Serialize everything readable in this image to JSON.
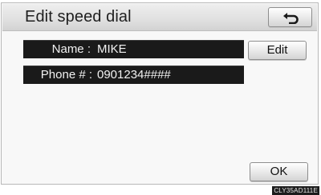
{
  "screen": {
    "title": "Edit speed dial",
    "back_icon": "return-arrow-icon"
  },
  "fields": {
    "name_label": "Name :",
    "name_value": "MIKE",
    "phone_label": "Phone # :",
    "phone_value": "0901234####"
  },
  "buttons": {
    "edit_label": "Edit",
    "ok_label": "OK"
  },
  "footer": {
    "image_code": "CLY35AD111E"
  },
  "colors": {
    "field_background": "#1a1a1a",
    "field_text": "#f2f2f2",
    "screen_background": "#f8f8f8"
  }
}
